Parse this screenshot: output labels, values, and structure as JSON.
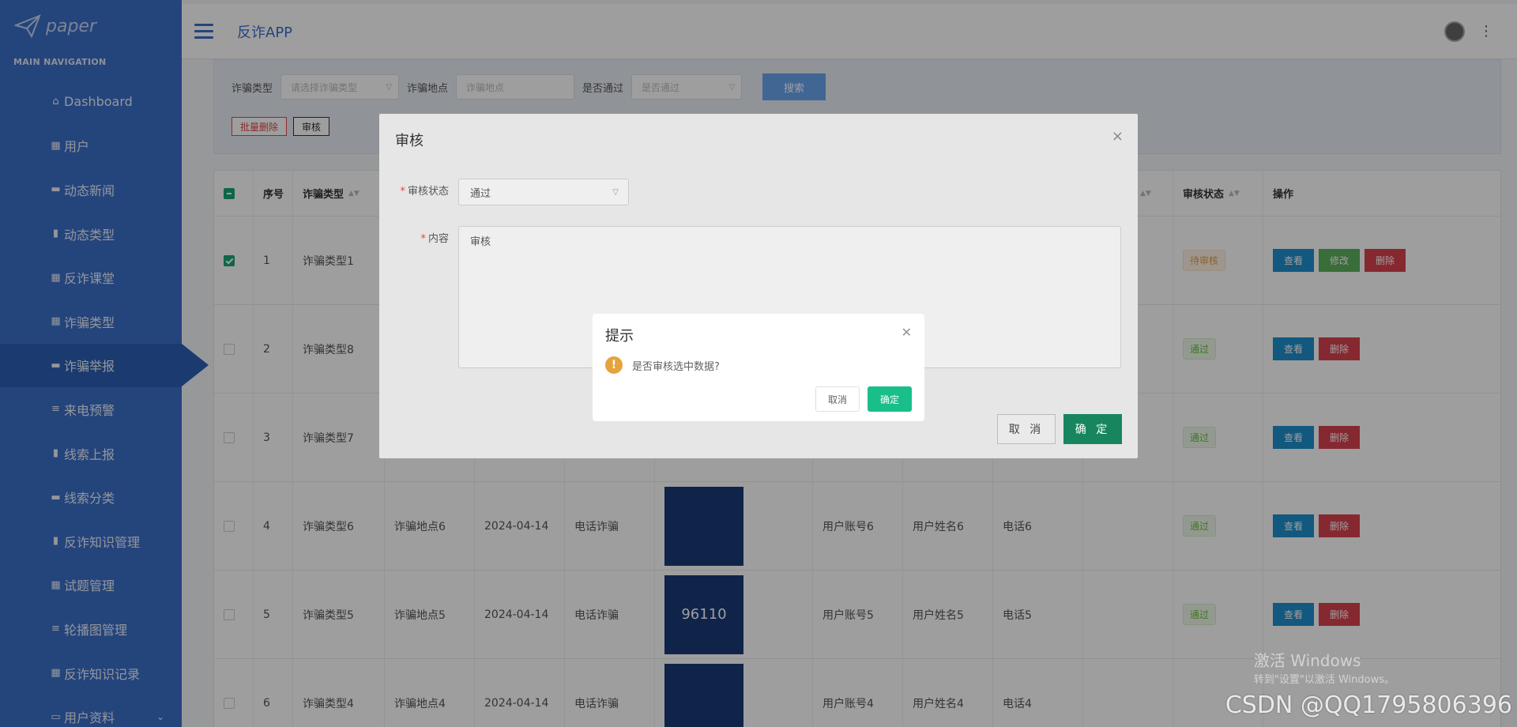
{
  "logo": {
    "text": "paper"
  },
  "nav": {
    "header": "MAIN NAVIGATION",
    "items": [
      {
        "label": "Dashboard",
        "icon": "⌂"
      },
      {
        "label": "用户",
        "icon": "▦"
      },
      {
        "label": "动态新闻",
        "icon": "▬"
      },
      {
        "label": "动态类型",
        "icon": "▮"
      },
      {
        "label": "反诈课堂",
        "icon": "▦"
      },
      {
        "label": "诈骗类型",
        "icon": "▦"
      },
      {
        "label": "诈骗举报",
        "icon": "▬"
      },
      {
        "label": "来电预警",
        "icon": "≡"
      },
      {
        "label": "线索上报",
        "icon": "▮"
      },
      {
        "label": "线索分类",
        "icon": "▬"
      },
      {
        "label": "反诈知识管理",
        "icon": "▮"
      },
      {
        "label": "试题管理",
        "icon": "▦"
      },
      {
        "label": "轮播图管理",
        "icon": "≡"
      },
      {
        "label": "反诈知识记录",
        "icon": "▦"
      },
      {
        "label": "用户资料",
        "icon": "▭"
      }
    ]
  },
  "topbar": {
    "title": "反诈APP"
  },
  "search": {
    "type_label": "诈骗类型",
    "type_placeholder": "请选择诈骗类型",
    "place_label": "诈骗地点",
    "place_placeholder": "诈骗地点",
    "passed_label": "是否通过",
    "passed_placeholder": "是否通过",
    "button": "搜索"
  },
  "actions": {
    "batch_delete": "批量删除",
    "review": "审核"
  },
  "table": {
    "headers": {
      "index": "序号",
      "type": "诈骗类型",
      "review_status": "审核状态",
      "ops": "操作"
    },
    "rows": [
      {
        "index": "1",
        "type": "诈骗类型1",
        "place": "",
        "date": "",
        "method": "",
        "account": "",
        "name": "",
        "phone": "",
        "status": "待审核",
        "view": "查看",
        "edit": "修改",
        "del": "删除"
      },
      {
        "index": "2",
        "type": "诈骗类型8",
        "place": "",
        "date": "",
        "method": "",
        "account": "",
        "name": "",
        "phone": "",
        "status": "通过",
        "view": "查看",
        "del": "删除"
      },
      {
        "index": "3",
        "type": "诈骗类型7",
        "place": "",
        "date": "",
        "method": "",
        "account": "",
        "name": "",
        "phone": "",
        "status": "通过",
        "view": "查看",
        "del": "删除"
      },
      {
        "index": "4",
        "type": "诈骗类型6",
        "place": "诈骗地点6",
        "date": "2024-04-14",
        "method": "电话诈骗",
        "account": "用户账号6",
        "name": "用户姓名6",
        "phone": "电话6",
        "status": "通过",
        "view": "查看",
        "del": "删除"
      },
      {
        "index": "5",
        "type": "诈骗类型5",
        "place": "诈骗地点5",
        "date": "2024-04-14",
        "method": "电话诈骗",
        "account": "用户账号5",
        "name": "用户姓名5",
        "phone": "电话5",
        "status": "通过",
        "view": "查看",
        "del": "删除"
      },
      {
        "index": "6",
        "type": "诈骗类型4",
        "place": "诈骗地点4",
        "date": "2024-04-14",
        "method": "电话诈骗",
        "account": "用户账号4",
        "name": "用户姓名4",
        "phone": "电话4",
        "status": "",
        "view": "",
        "del": ""
      }
    ],
    "thumb5_text": "96110"
  },
  "review_dialog": {
    "title": "审核",
    "status_label": "审核状态",
    "status_value": "通过",
    "content_label": "内容",
    "content_value": "审核",
    "cancel": "取 消",
    "ok": "确 定"
  },
  "confirm": {
    "title": "提示",
    "message": "是否审核选中数据?",
    "cancel": "取消",
    "ok": "确定"
  },
  "os_overlay": {
    "activate_title": "激活 Windows",
    "activate_sub": "转到\"设置\"以激活 Windows。",
    "watermark": "CSDN @QQ1795806396"
  }
}
